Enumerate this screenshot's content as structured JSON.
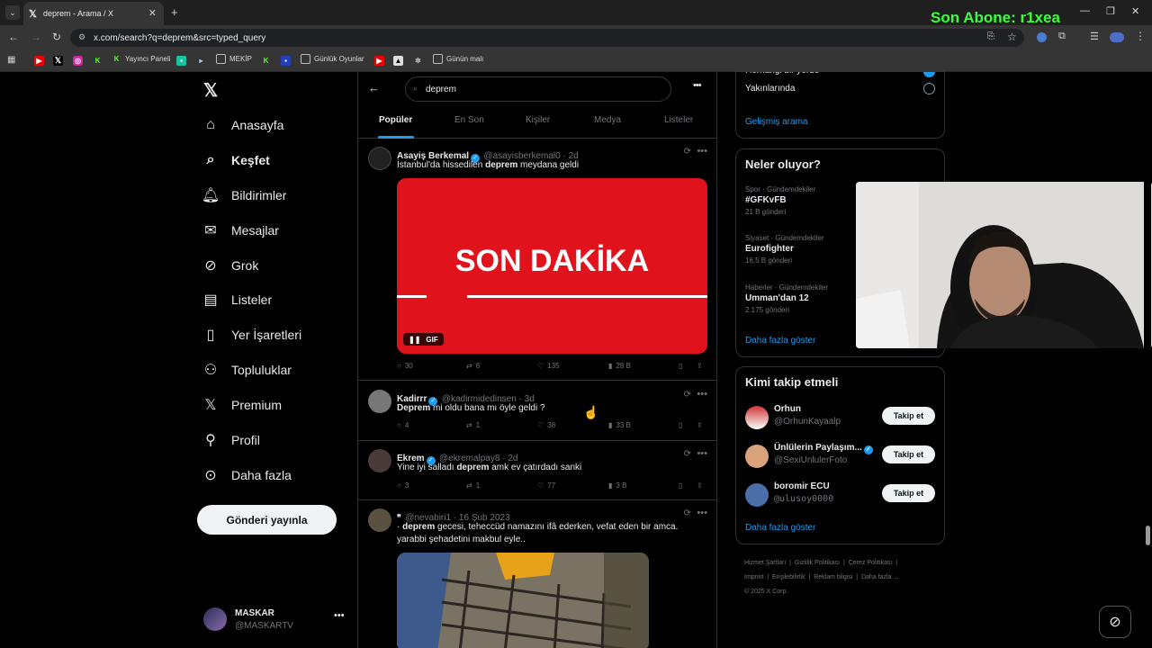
{
  "browser": {
    "tab_title": "deprem - Arama / X",
    "url": "x.com/search?q=deprem&src=typed_query",
    "bookmarks": [
      "Yayıncı Paneli",
      "MEKİP",
      "Günlük Oyunlar",
      "Günün malı"
    ]
  },
  "overlay": {
    "son_abone": "Son Abone: r1xea"
  },
  "nav": {
    "items": [
      {
        "label": "Anasayfa",
        "icon": "home-icon"
      },
      {
        "label": "Keşfet",
        "icon": "search-icon"
      },
      {
        "label": "Bildirimler",
        "icon": "bell-icon"
      },
      {
        "label": "Mesajlar",
        "icon": "mail-icon"
      },
      {
        "label": "Grok",
        "icon": "grok-icon"
      },
      {
        "label": "Listeler",
        "icon": "list-icon"
      },
      {
        "label": "Yer İşaretleri",
        "icon": "bookmark-icon"
      },
      {
        "label": "Topluluklar",
        "icon": "people-icon"
      },
      {
        "label": "Premium",
        "icon": "x-logo-icon"
      },
      {
        "label": "Profil",
        "icon": "user-icon"
      },
      {
        "label": "Daha fazla",
        "icon": "more-circle-icon"
      }
    ],
    "post_button": "Gönderi yayınla",
    "profile": {
      "name": "MASKAR",
      "handle": "@MASKARTV"
    }
  },
  "search": {
    "query": "deprem"
  },
  "tabs": [
    "Popüler",
    "En Son",
    "Kişiler",
    "Medya",
    "Listeler"
  ],
  "tweets": [
    {
      "name": "Asayiş Berkemal",
      "handle": "@asayisberkemal0 · 2d",
      "text_pre": "İstanbul'da hissedilen ",
      "text_bold": "deprem",
      "text_post": " meydana geldi",
      "media_text": "SON DAKİKA",
      "media_badge": "GIF",
      "stats": {
        "replies": "30",
        "reposts": "6",
        "likes": "135",
        "views": "28 B"
      }
    },
    {
      "name": "Kadirrr",
      "handle": "@kadirmidedinsen · 3d",
      "text_bold": "Deprem",
      "text_post": " mi oldu bana mı öyle geldi ?",
      "stats": {
        "replies": "4",
        "reposts": "1",
        "likes": "38",
        "views": "33 B"
      }
    },
    {
      "name": "Ekrem",
      "handle": "@ekremalpay8 · 2d",
      "text_pre": "Yine iyi salladı ",
      "text_bold": "deprem",
      "text_post": " amk ev çatırdadı sanki",
      "stats": {
        "replies": "3",
        "reposts": "1",
        "likes": "77",
        "views": "3 B"
      }
    },
    {
      "name": "❞",
      "handle": "@nevabiri1 · 16 Şub 2023",
      "text_pre": "· ",
      "text_bold": "deprem",
      "text_post": " gecesi, teheccüd namazını ifâ ederken, vefat eden bir amca.",
      "text_line2": "yarabbi şehadetini makbul eyle.."
    }
  ],
  "right": {
    "location_options": [
      "Herhangi bir yerde",
      "Yakınlarında"
    ],
    "advanced_search": "Gelişmiş arama",
    "trends_title": "Neler oluyor?",
    "trends": [
      {
        "context": "Spor · Gündemdekiler",
        "name": "#GFKvFB",
        "count": "21 B gönderi"
      },
      {
        "context": "Siyaset · Gündemdekiler",
        "name": "Eurofighter",
        "count": "16,5 B gönderi"
      },
      {
        "context": "Haberler · Gündemdekiler",
        "name": "Umman'dan 12",
        "count": "2.175 gönderi"
      }
    ],
    "show_more": "Daha fazla göster",
    "who_to_follow_title": "Kimi takip etmeli",
    "who_to_follow": [
      {
        "name": "Orhun",
        "handle": "@OrhunKayaalp",
        "verified": false
      },
      {
        "name": "Ünlülerin Paylaşım...",
        "handle": "@SexiUnlulerFoto",
        "verified": true
      },
      {
        "name": "boromir ECU",
        "handle": "@ulusoy0000",
        "verified": false
      }
    ],
    "follow_label": "Takip et",
    "footer": [
      "Hizmet Şartları",
      "Gizlilik Politikası",
      "Çerez Politikası",
      "Imprint",
      "Erişilebilirlik",
      "Reklam bilgisi",
      "Daha fazla ...",
      "© 2025 X Corp."
    ]
  },
  "colors": {
    "accent": "#1d9bf0",
    "overlay_green": "#3cff3c",
    "gif_red": "#e0121b"
  }
}
